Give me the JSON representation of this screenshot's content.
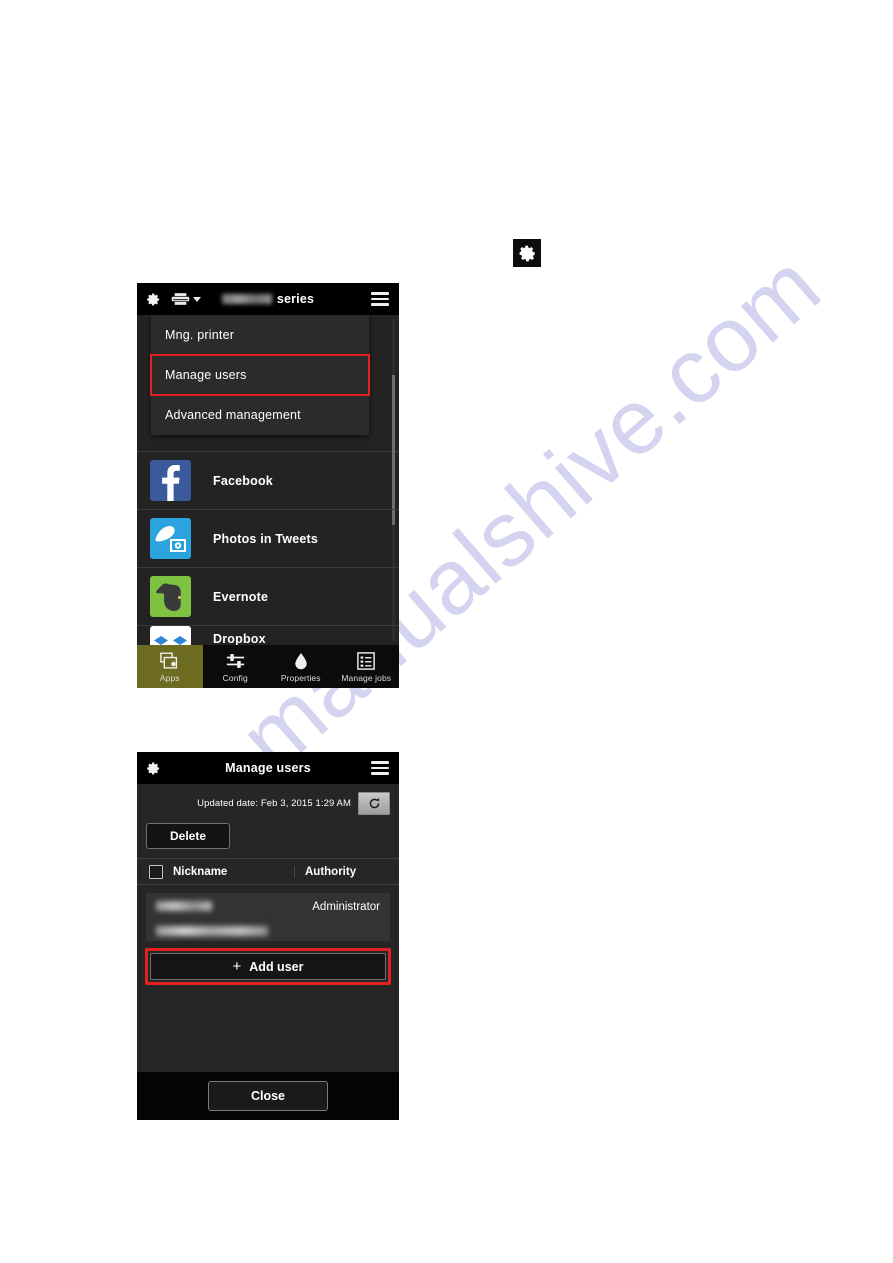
{
  "page": {
    "background": "#ffffff",
    "watermark_text": "manualshive.com",
    "watermark_color": "#c9c8ec"
  },
  "inline_gear_icon": {
    "name": "gear-icon",
    "background": "#0d0d0d",
    "glyph_color": "#ffffff"
  },
  "screenshot_apps": {
    "header": {
      "gear_icon": "gear-icon",
      "printer_icon": "printer-icon",
      "printer_caret_icon": "caret-down-icon",
      "model_name_redacted": "",
      "title_suffix": "series",
      "menu_icon": "hamburger-menu-icon"
    },
    "dropdown": {
      "items": [
        {
          "label": "Mng. printer",
          "highlighted": false
        },
        {
          "label": "Manage users",
          "highlighted": true
        },
        {
          "label": "Advanced management",
          "highlighted": false
        }
      ],
      "highlight_color": "#e52020"
    },
    "apps": [
      {
        "label": "Facebook",
        "icon": "facebook-icon",
        "color": "#3a5a9b",
        "partial": false
      },
      {
        "label": "Photos in Tweets",
        "icon": "twitter-bird-icon",
        "color": "#2ba3dd",
        "partial": false
      },
      {
        "label": "Evernote",
        "icon": "evernote-icon",
        "color": "#7fc242",
        "partial": false
      },
      {
        "label": "Dropbox",
        "icon": "dropbox-icon",
        "color": "#ffffff",
        "partial": true
      }
    ],
    "tabs": [
      {
        "label": "Apps",
        "icon": "apps-icon",
        "active": true
      },
      {
        "label": "Config",
        "icon": "sliders-icon",
        "active": false
      },
      {
        "label": "Properties",
        "icon": "ink-drop-icon",
        "active": false
      },
      {
        "label": "Manage jobs",
        "icon": "checklist-icon",
        "active": false
      }
    ],
    "active_tab_color": "#6d6b22"
  },
  "screenshot_users": {
    "header": {
      "gear_icon": "gear-icon",
      "title": "Manage users",
      "menu_icon": "hamburger-menu-icon"
    },
    "updated_date": "Updated date: Feb 3, 2015 1:29 AM",
    "refresh_icon": "refresh-icon",
    "delete_label": "Delete",
    "table": {
      "select_all_checkbox": "select-all-checkbox",
      "columns": [
        "Nickname",
        "Authority"
      ],
      "rows": [
        {
          "nickname_redacted": "",
          "email_redacted": "",
          "authority": "Administrator"
        }
      ]
    },
    "add_user": {
      "label": "Add user",
      "plus_glyph": "+",
      "highlight_color": "#e52020"
    },
    "close_label": "Close"
  }
}
